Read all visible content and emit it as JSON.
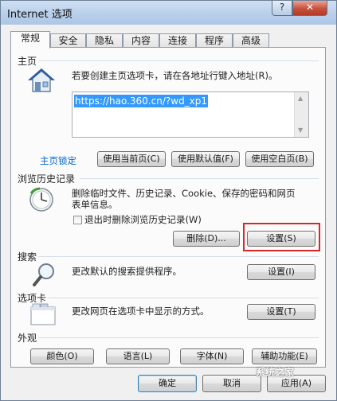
{
  "window": {
    "title": "Internet 选项",
    "help_label": "?",
    "close_label": "✕"
  },
  "tabs": [
    "常规",
    "安全",
    "隐私",
    "内容",
    "连接",
    "程序",
    "高级"
  ],
  "home": {
    "heading": "主页",
    "description": "若要创建主页选项卡，请在各地址行键入地址(R)。",
    "url": "https://hao.360.cn/?wd_xp1",
    "lock_label": "主页锁定",
    "btn_current": "使用当前页(C)",
    "btn_default": "使用默认值(F)",
    "btn_blank": "使用空白页(B)"
  },
  "history": {
    "heading": "浏览历史记录",
    "description": "删除临时文件、历史记录、Cookie、保存的密码和网页表单信息。",
    "checkbox_label": "退出时删除浏览历史记录(W)",
    "btn_delete": "删除(D)...",
    "btn_settings": "设置(S)"
  },
  "search": {
    "heading": "搜索",
    "description": "更改默认的搜索提供程序。",
    "btn_settings": "设置(I)"
  },
  "tabs_section": {
    "heading": "选项卡",
    "description": "更改网页在选项卡中显示的方式。",
    "btn_settings": "设置(T)"
  },
  "appearance": {
    "heading": "外观",
    "btn_colors": "颜色(O)",
    "btn_languages": "语言(L)",
    "btn_fonts": "字体(N)",
    "btn_accessibility": "辅助功能(E)"
  },
  "footer": {
    "ok": "确定",
    "cancel": "取消",
    "apply": "应用(A)"
  },
  "watermark": "系统之家",
  "colors": {
    "highlight": "#d9262b",
    "link": "#0066cc",
    "selection": "#3399ff"
  }
}
